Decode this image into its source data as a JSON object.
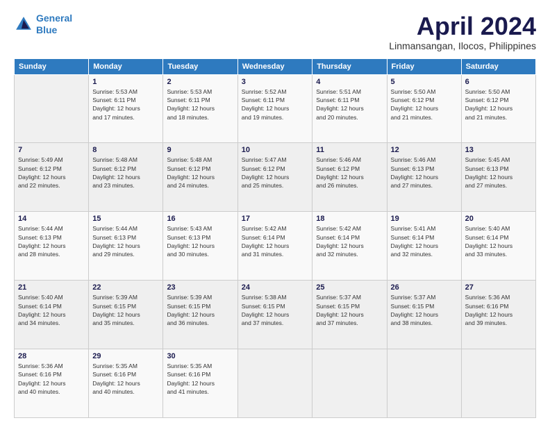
{
  "header": {
    "logo_line1": "General",
    "logo_line2": "Blue",
    "title": "April 2024",
    "subtitle": "Linmansangan, Ilocos, Philippines"
  },
  "calendar": {
    "weekdays": [
      "Sunday",
      "Monday",
      "Tuesday",
      "Wednesday",
      "Thursday",
      "Friday",
      "Saturday"
    ],
    "weeks": [
      [
        {
          "day": "",
          "info": ""
        },
        {
          "day": "1",
          "info": "Sunrise: 5:53 AM\nSunset: 6:11 PM\nDaylight: 12 hours\nand 17 minutes."
        },
        {
          "day": "2",
          "info": "Sunrise: 5:53 AM\nSunset: 6:11 PM\nDaylight: 12 hours\nand 18 minutes."
        },
        {
          "day": "3",
          "info": "Sunrise: 5:52 AM\nSunset: 6:11 PM\nDaylight: 12 hours\nand 19 minutes."
        },
        {
          "day": "4",
          "info": "Sunrise: 5:51 AM\nSunset: 6:11 PM\nDaylight: 12 hours\nand 20 minutes."
        },
        {
          "day": "5",
          "info": "Sunrise: 5:50 AM\nSunset: 6:12 PM\nDaylight: 12 hours\nand 21 minutes."
        },
        {
          "day": "6",
          "info": "Sunrise: 5:50 AM\nSunset: 6:12 PM\nDaylight: 12 hours\nand 21 minutes."
        }
      ],
      [
        {
          "day": "7",
          "info": "Sunrise: 5:49 AM\nSunset: 6:12 PM\nDaylight: 12 hours\nand 22 minutes."
        },
        {
          "day": "8",
          "info": "Sunrise: 5:48 AM\nSunset: 6:12 PM\nDaylight: 12 hours\nand 23 minutes."
        },
        {
          "day": "9",
          "info": "Sunrise: 5:48 AM\nSunset: 6:12 PM\nDaylight: 12 hours\nand 24 minutes."
        },
        {
          "day": "10",
          "info": "Sunrise: 5:47 AM\nSunset: 6:12 PM\nDaylight: 12 hours\nand 25 minutes."
        },
        {
          "day": "11",
          "info": "Sunrise: 5:46 AM\nSunset: 6:12 PM\nDaylight: 12 hours\nand 26 minutes."
        },
        {
          "day": "12",
          "info": "Sunrise: 5:46 AM\nSunset: 6:13 PM\nDaylight: 12 hours\nand 27 minutes."
        },
        {
          "day": "13",
          "info": "Sunrise: 5:45 AM\nSunset: 6:13 PM\nDaylight: 12 hours\nand 27 minutes."
        }
      ],
      [
        {
          "day": "14",
          "info": "Sunrise: 5:44 AM\nSunset: 6:13 PM\nDaylight: 12 hours\nand 28 minutes."
        },
        {
          "day": "15",
          "info": "Sunrise: 5:44 AM\nSunset: 6:13 PM\nDaylight: 12 hours\nand 29 minutes."
        },
        {
          "day": "16",
          "info": "Sunrise: 5:43 AM\nSunset: 6:13 PM\nDaylight: 12 hours\nand 30 minutes."
        },
        {
          "day": "17",
          "info": "Sunrise: 5:42 AM\nSunset: 6:14 PM\nDaylight: 12 hours\nand 31 minutes."
        },
        {
          "day": "18",
          "info": "Sunrise: 5:42 AM\nSunset: 6:14 PM\nDaylight: 12 hours\nand 32 minutes."
        },
        {
          "day": "19",
          "info": "Sunrise: 5:41 AM\nSunset: 6:14 PM\nDaylight: 12 hours\nand 32 minutes."
        },
        {
          "day": "20",
          "info": "Sunrise: 5:40 AM\nSunset: 6:14 PM\nDaylight: 12 hours\nand 33 minutes."
        }
      ],
      [
        {
          "day": "21",
          "info": "Sunrise: 5:40 AM\nSunset: 6:14 PM\nDaylight: 12 hours\nand 34 minutes."
        },
        {
          "day": "22",
          "info": "Sunrise: 5:39 AM\nSunset: 6:15 PM\nDaylight: 12 hours\nand 35 minutes."
        },
        {
          "day": "23",
          "info": "Sunrise: 5:39 AM\nSunset: 6:15 PM\nDaylight: 12 hours\nand 36 minutes."
        },
        {
          "day": "24",
          "info": "Sunrise: 5:38 AM\nSunset: 6:15 PM\nDaylight: 12 hours\nand 37 minutes."
        },
        {
          "day": "25",
          "info": "Sunrise: 5:37 AM\nSunset: 6:15 PM\nDaylight: 12 hours\nand 37 minutes."
        },
        {
          "day": "26",
          "info": "Sunrise: 5:37 AM\nSunset: 6:15 PM\nDaylight: 12 hours\nand 38 minutes."
        },
        {
          "day": "27",
          "info": "Sunrise: 5:36 AM\nSunset: 6:16 PM\nDaylight: 12 hours\nand 39 minutes."
        }
      ],
      [
        {
          "day": "28",
          "info": "Sunrise: 5:36 AM\nSunset: 6:16 PM\nDaylight: 12 hours\nand 40 minutes."
        },
        {
          "day": "29",
          "info": "Sunrise: 5:35 AM\nSunset: 6:16 PM\nDaylight: 12 hours\nand 40 minutes."
        },
        {
          "day": "30",
          "info": "Sunrise: 5:35 AM\nSunset: 6:16 PM\nDaylight: 12 hours\nand 41 minutes."
        },
        {
          "day": "",
          "info": ""
        },
        {
          "day": "",
          "info": ""
        },
        {
          "day": "",
          "info": ""
        },
        {
          "day": "",
          "info": ""
        }
      ]
    ]
  }
}
